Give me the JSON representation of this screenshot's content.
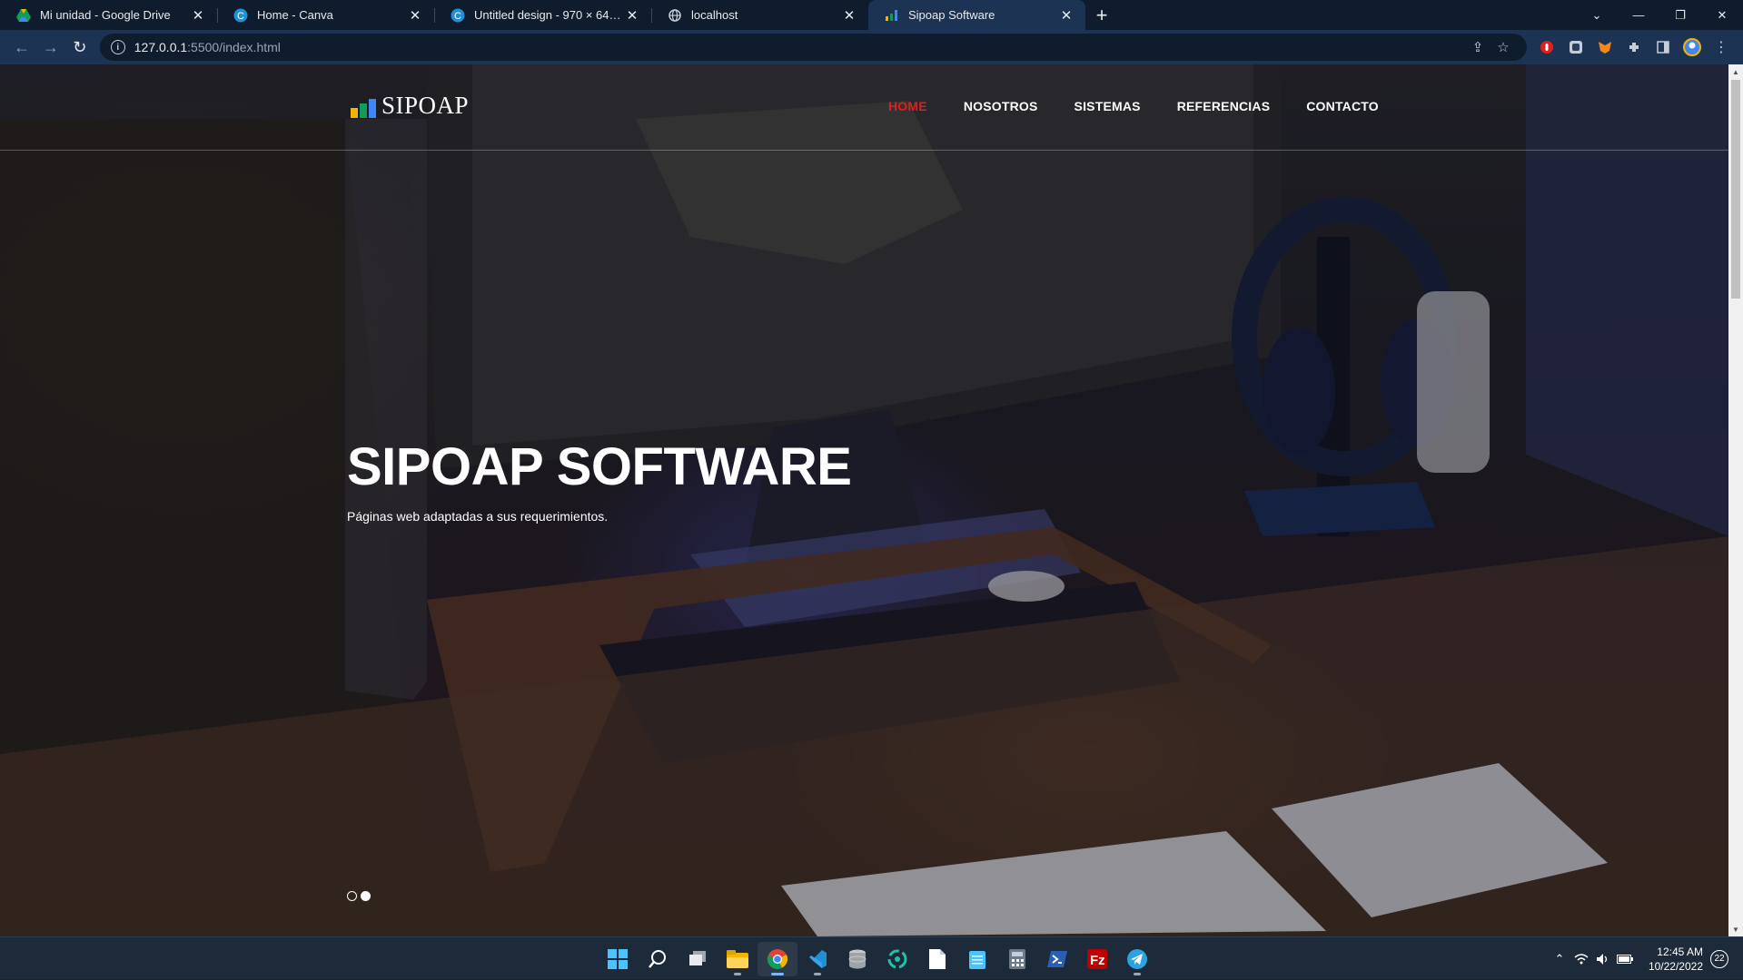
{
  "browser": {
    "tabs": [
      {
        "title": "Mi unidad - Google Drive",
        "icon": "google-drive-icon"
      },
      {
        "title": "Home - Canva",
        "icon": "canva-icon"
      },
      {
        "title": "Untitled design - 970 × 647px",
        "icon": "canva-icon"
      },
      {
        "title": "localhost",
        "icon": "globe-icon"
      },
      {
        "title": "Sipoap Software",
        "icon": "bar-chart-icon",
        "active": true
      }
    ],
    "new_tab": "+",
    "url_host": "127.0.0.1",
    "url_path": ":5500/index.html"
  },
  "site": {
    "logo_text": "SIPOAP",
    "nav": [
      {
        "label": "HOME",
        "active": true
      },
      {
        "label": "NOSOTROS"
      },
      {
        "label": "SISTEMAS"
      },
      {
        "label": "REFERENCIAS"
      },
      {
        "label": "CONTACTO"
      }
    ],
    "hero_title": "SIPOAP SOFTWARE",
    "hero_subtitle": "Páginas web adaptadas a sus requerimientos.",
    "carousel": {
      "slides": 2,
      "current": 2
    },
    "accent_color": "#e0201c",
    "logo_colors": [
      "#f4b400",
      "#0f9d58",
      "#4285f4"
    ]
  },
  "taskbar": {
    "apps": [
      "windows-start-icon",
      "search-icon",
      "task-view-icon",
      "file-explorer-icon",
      "chrome-icon",
      "vscode-icon",
      "database-icon",
      "sync-icon",
      "document-icon",
      "notepad-icon",
      "calculator-icon",
      "powershell-icon",
      "filezilla-icon",
      "telegram-icon"
    ],
    "time": "12:45 AM",
    "date": "10/22/2022",
    "notifications": "22"
  }
}
